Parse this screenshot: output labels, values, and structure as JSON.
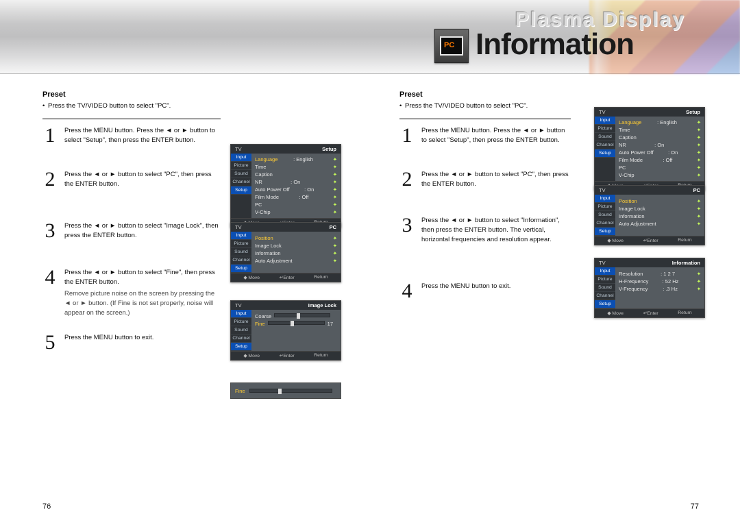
{
  "brand": "Plasma Display",
  "pc_badge": "PC",
  "section_title": "Information",
  "page_left_num": "76",
  "page_right_num": "77",
  "left": {
    "heading": "Preset",
    "bullet": "Press the TV/VIDEO button to select \"PC\".",
    "steps": {
      "s1": "Press the MENU button. Press the ◄ or ► button to select \"Setup\", then press the ENTER button.",
      "s2": "Press the ◄ or ► button to select \"PC\", then press the ENTER button.",
      "s3": "Press the ◄ or ► button to select \"Image Lock\", then press the ENTER button.",
      "s4": "Press the ◄ or ► button to select \"Fine\", then press the ENTER button.",
      "s4b": "Remove picture noise on the screen by pressing the ◄ or ► button. (If Fine is not set properly, noise will appear on the screen.)",
      "s5": "Press the MENU button to exit."
    }
  },
  "right": {
    "heading": "Preset",
    "bullet": "Press the TV/VIDEO button to select \"PC\".",
    "steps": {
      "s1": "Press the MENU button. Press the ◄ or ► button to select \"Setup\", then press the ENTER button.",
      "s2": "Press the ◄ or ► button to select \"PC\", then press the ENTER button.",
      "s3": "Press the ◄ or ► button to select \"Information\", then press the ENTER button. The vertical, horizontal frequencies and resolution appear.",
      "s4": "Press the MENU button to exit."
    }
  },
  "osd": {
    "tv": "TV",
    "side": [
      "Input",
      "Picture",
      "Sound",
      "Channel",
      "Setup"
    ],
    "foot": {
      "move": "◆ Move",
      "enter": "↵Enter",
      "return": "Return"
    },
    "setup": {
      "title": "Setup",
      "rows": [
        {
          "l": "Language",
          "v": ": English",
          "hl": true
        },
        {
          "l": "Time",
          "v": ""
        },
        {
          "l": "Caption",
          "v": ""
        },
        {
          "l": "NR",
          "v": ": On"
        },
        {
          "l": "Auto Power Off",
          "v": ": On"
        },
        {
          "l": "Film Mode",
          "v": ": Off"
        },
        {
          "l": "PC",
          "v": ""
        },
        {
          "l": "V-Chip",
          "v": ""
        }
      ]
    },
    "pc": {
      "title": "PC",
      "rows": [
        {
          "l": "Position",
          "v": "",
          "hl": true
        },
        {
          "l": "Image Lock",
          "v": ""
        },
        {
          "l": "Information",
          "v": ""
        },
        {
          "l": "Auto Adjustment",
          "v": ""
        }
      ]
    },
    "imagelock": {
      "title": "Image Lock",
      "rows": [
        {
          "l": "Coarse",
          "slider": true,
          "val": ""
        },
        {
          "l": "Fine",
          "slider": true,
          "val": "17",
          "hl": true
        }
      ]
    },
    "fine_label": "Fine",
    "information": {
      "title": "Information",
      "rows": [
        {
          "l": "Resolution",
          "v": ": 1 2    7"
        },
        {
          "l": "H-Frequency",
          "v": ": 52   Hz"
        },
        {
          "l": "V-Frequency",
          "v": ":  .3  Hz"
        }
      ]
    }
  }
}
